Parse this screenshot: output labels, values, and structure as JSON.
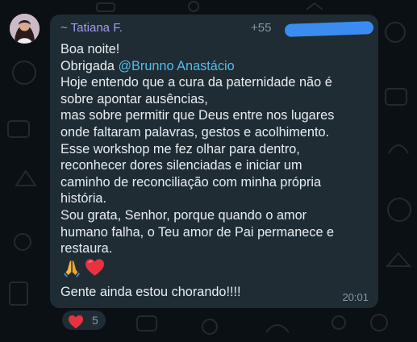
{
  "sender": {
    "name": "~ Tatiana F.",
    "phone": "+55"
  },
  "message": {
    "lines": [
      "Boa noite!",
      "Obrigada ",
      "Hoje entendo que a cura da paternidade não é",
      "sobre apontar ausências,",
      "mas sobre permitir que Deus entre nos lugares",
      "onde faltaram palavras, gestos e acolhimento.",
      "Esse workshop me fez olhar para dentro,",
      "reconhecer dores silenciadas e iniciar um",
      "caminho de reconciliação com minha própria",
      "história.",
      "Sou grata, Senhor, porque quando o amor",
      "humano falha, o Teu amor de Pai permanece e",
      "restaura."
    ],
    "mention": "@Brunno Anastácio",
    "emojis": [
      "praying-hands-icon",
      "red-heart-icon"
    ],
    "last_line": "Gente ainda estou chorando!!!!",
    "time": "20:01"
  },
  "reaction": {
    "emoji": "red-heart-icon",
    "count": "5"
  },
  "colors": {
    "background": "#0b1014",
    "bubble": "#1f2c34",
    "sender_name": "#a59bf2",
    "mention": "#53bdeb",
    "text": "#e9edef",
    "meta": "#8696a0",
    "redaction": "#3a8cf0"
  }
}
